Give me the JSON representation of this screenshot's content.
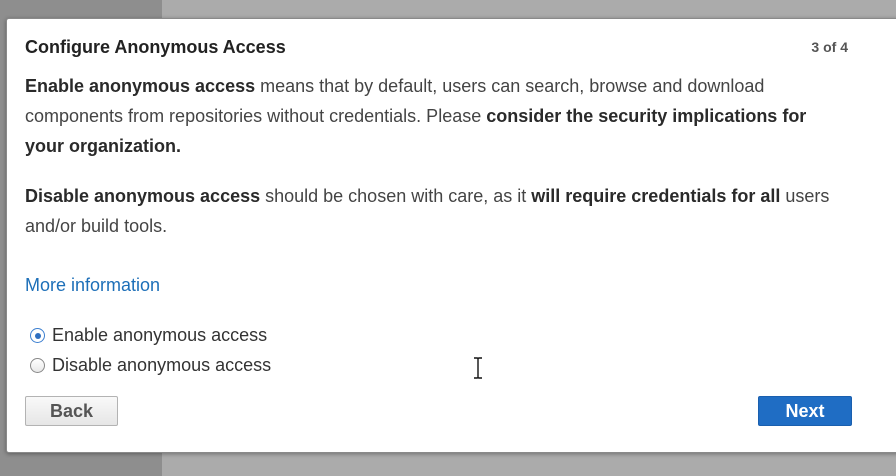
{
  "dialog": {
    "title": "Configure Anonymous Access",
    "step": "3 of 4",
    "para1": {
      "b1": "Enable anonymous access",
      "t1": " means that by default, users can search, browse and download components from repositories without credentials. Please ",
      "b2": "consider the security implications for your organization."
    },
    "para2": {
      "b1": "Disable anonymous access",
      "t1": " should be chosen with care, as it ",
      "b2": "will require credentials for all",
      "t2": " users and/or build tools."
    },
    "more_link": "More information",
    "options": {
      "enable": {
        "label": "Enable anonymous access",
        "checked": true
      },
      "disable": {
        "label": "Disable anonymous access",
        "checked": false
      }
    },
    "back_label": "Back",
    "next_label": "Next"
  },
  "colors": {
    "primary": "#1f6dc4",
    "link": "#1d6fb8",
    "backdrop": "#ababab"
  },
  "icons": {
    "cursor": "text-cursor-icon"
  }
}
